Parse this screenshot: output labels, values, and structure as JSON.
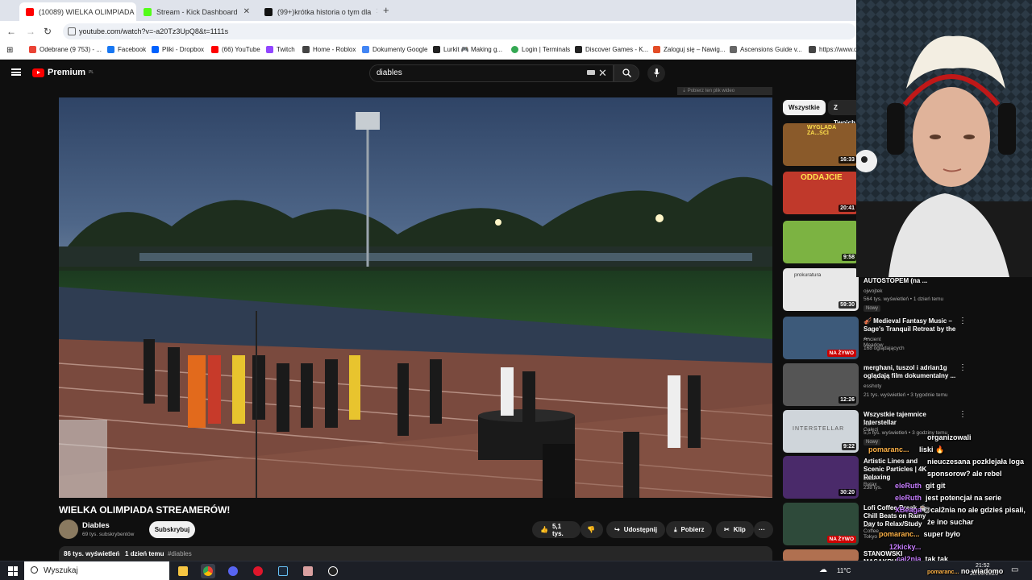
{
  "tabs": [
    {
      "label": "(10089) WIELKA OLIMPIADA ST",
      "color": "#ff0000",
      "active": true
    },
    {
      "label": "Stream - Kick Dashboard",
      "color": "#53fc18",
      "active": false
    },
    {
      "label": "(99+)krótka historia o tym dla",
      "color": "#111111",
      "active": false
    }
  ],
  "address": {
    "url": "youtube.com/watch?v=-a20Tz3UpQ8&t=1111s"
  },
  "bookmarks": [
    {
      "label": "Odebrane (9 753) - ...",
      "color": "#ea4335"
    },
    {
      "label": "Facebook",
      "color": "#1877f2"
    },
    {
      "label": "Pliki - Dropbox",
      "color": "#0061fe"
    },
    {
      "label": "(66) YouTube",
      "color": "#ff0000"
    },
    {
      "label": "Twitch",
      "color": "#9146ff"
    },
    {
      "label": "Home - Roblox",
      "color": "#444444"
    },
    {
      "label": "Dokumenty Google",
      "color": "#4285f4"
    },
    {
      "label": "Lurkit 🎮 Making g...",
      "color": "#222222"
    },
    {
      "label": "Login | Terminals",
      "color": "#34a853"
    },
    {
      "label": "Discover Games - K...",
      "color": "#222222"
    },
    {
      "label": "Zaloguj się – Nawig...",
      "color": "#e34c26"
    },
    {
      "label": "Ascensions Guide v...",
      "color": "#666666"
    },
    {
      "label": "https://www.d",
      "color": "#444444"
    }
  ],
  "youtube": {
    "logo_text": "Premium",
    "logo_region": "PL",
    "search_value": "diables",
    "download_hint": "⇣ Pobierz ten plik wideo",
    "video_title": "WIELKA OLIMPIADA STREAMERÓW!",
    "channel_name": "Diables",
    "channel_subs": "69 tys. subskrybentów",
    "subscribe_label": "Subskrybuj",
    "likes": "5,1 tys.",
    "share_label": "Udostępnij",
    "download_label": "Pobierz",
    "clip_label": "Klip",
    "more_label": "···",
    "views": "86 tys. wyświetleń",
    "age": "1 dzień temu",
    "hashtag": "#diables"
  },
  "sidebar": {
    "chips": [
      "Wszystkie",
      "Z Twoich"
    ],
    "recommendations": [
      {
        "title": "",
        "channel": "",
        "meta": "",
        "duration": "16:33",
        "live": false,
        "thumb_color": "#8a5a2a",
        "thumb_text": "WYGLĄDA ZA...ŚCI"
      },
      {
        "title": "",
        "channel": "",
        "meta": "",
        "duration": "20:41",
        "live": false,
        "thumb_color": "#c0392b",
        "thumb_text": "ODDAJCIE"
      },
      {
        "title": "",
        "channel": "",
        "meta": "",
        "duration": "9:58",
        "live": false,
        "thumb_color": "#7cb342",
        "thumb_text": ""
      },
      {
        "title": "AUTOSTOPEM (na ...",
        "channel": "ojwojtek",
        "meta": "564 tys. wyświetleń • 1 dzień temu",
        "badge": "Nowy",
        "duration": "59:30",
        "live": false,
        "thumb_color": "#e8e8e8",
        "thumb_text": "prokuratura"
      },
      {
        "title": "🎻 Medieval Fantasy Music – Sage's Tranquil Retreat by the ...",
        "channel": "Ancient Meadow",
        "meta": "168 oglądających",
        "duration": "NA ŻYWO",
        "live": true,
        "thumb_color": "#3d5a7a",
        "thumb_text": ""
      },
      {
        "title": "merghani, tuszol i adrian1g oglądają film dokumentalny ...",
        "channel": "esshoty",
        "meta": "21 tys. wyświetleń • 3 tygodnie temu",
        "duration": "12:26",
        "live": false,
        "thumb_color": "#555555",
        "thumb_text": ""
      },
      {
        "title": "Wszystkie tajemnice Interstellar",
        "channel": "Na Gałęzi",
        "meta": "5,5 tys. wyświetleń • 3 godziny temu",
        "badge": "Nowy",
        "duration": "9:22",
        "live": false,
        "thumb_color": "#cfd5da",
        "thumb_text": "INTERSTELLAR"
      },
      {
        "title": "Artistic Lines and Scenic Particles | 4K Relaxing",
        "channel": "Josu Relax",
        "meta": "238 tys.",
        "duration": "30:20",
        "live": false,
        "thumb_color": "#4a2a6a",
        "thumb_text": ""
      },
      {
        "title": "Lofi Coffee Break ☕ Chill Beats on Rainy Day to Relax/Study",
        "channel": "Lofi Coffee Tokyo",
        "meta": "",
        "duration": "NA ŻYWO",
        "live": true,
        "thumb_color": "#2e4a3a",
        "thumb_text": ""
      },
      {
        "title": "STANOWSKI MASAKRUJE",
        "channel": "",
        "meta": "",
        "duration": "",
        "live": false,
        "thumb_color": "#b07050",
        "thumb_text": ""
      }
    ]
  },
  "chat": [
    {
      "user": "",
      "message": "organizowali",
      "color": "#ffffff"
    },
    {
      "user": "pomaranc...",
      "message": "liski 🔥",
      "color": "#ffb347"
    },
    {
      "user": "",
      "message": "nieuczesana pozklejała loga",
      "color": "#ffffff"
    },
    {
      "user": "",
      "message": "sponsorow? ale rebel",
      "color": "#ffffff"
    },
    {
      "user": "eleRuth",
      "message": "git git",
      "color": "#c77dff"
    },
    {
      "user": "eleRuth",
      "message": "jest potencjał na serie",
      "color": "#c77dff"
    },
    {
      "user": "XBeaga",
      "message": "@cal2nia no ale gdzieś pisali,",
      "color": "#c77dff"
    },
    {
      "user": "",
      "message": "że ino suchar",
      "color": "#ffffff"
    },
    {
      "user": "pomaranc...",
      "message": "super było",
      "color": "#ffb347"
    },
    {
      "user": "12kicky...",
      "message": "",
      "color": "#c77dff"
    },
    {
      "user": "cal2nia",
      "message": "tak tak",
      "color": "#c77dff"
    },
    {
      "user": "pomaranc...",
      "message": "no wiadomo",
      "color": "#ffb347"
    }
  ],
  "taskbar": {
    "search_placeholder": "Wyszukaj",
    "weather": "11°C",
    "time": "21:52",
    "date": "22.09.2025"
  }
}
